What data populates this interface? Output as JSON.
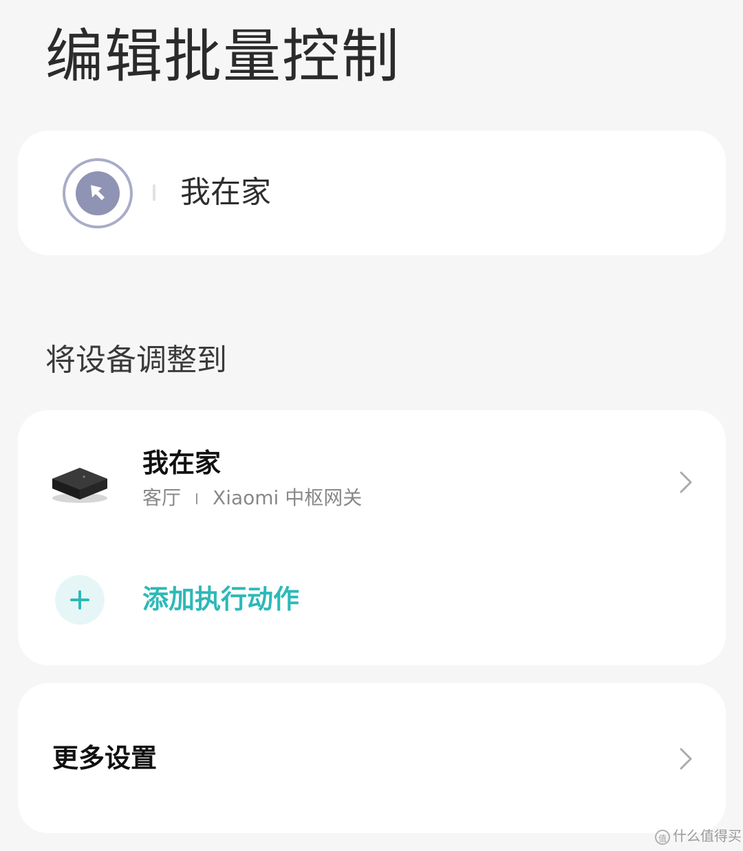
{
  "header": {
    "title": "编辑批量控制"
  },
  "scene": {
    "icon": "cursor-arrow-icon",
    "name": "我在家"
  },
  "section": {
    "title": "将设备调整到"
  },
  "action": {
    "device_title": "我在家",
    "room": "客厅",
    "device_name": "Xiaomi 中枢网关",
    "device_image": "gateway-device-icon"
  },
  "add_action": {
    "label": "添加执行动作",
    "icon": "plus-icon"
  },
  "more_settings": {
    "label": "更多设置"
  },
  "watermark": {
    "badge": "值",
    "text": "什么值得买"
  },
  "colors": {
    "background": "#f6f6f6",
    "card": "#ffffff",
    "accent": "#2cb9b8",
    "scene_icon": "#8f93b4",
    "scene_ring": "#a9acc8"
  }
}
